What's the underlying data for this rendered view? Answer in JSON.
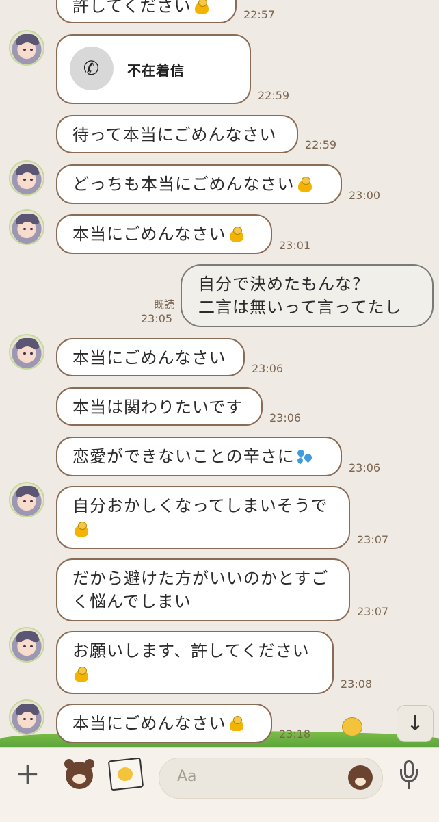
{
  "messages": [
    {
      "text": "許してください",
      "time": "22:57"
    },
    {
      "type": "missed_call",
      "label": "不在着信",
      "time": "22:59"
    },
    {
      "text": "待って本当にごめんなさい",
      "time": "22:59"
    },
    {
      "text": "どっちも本当にごめんなさい",
      "time": "23:00"
    },
    {
      "text": "本当にごめんなさい",
      "time": "23:01"
    },
    {
      "direction": "out",
      "line1": "自分で決めたもんな？",
      "line2": "二言は無いって言ってたし",
      "read": "既読",
      "time": "23:05"
    },
    {
      "text": "本当にごめんなさい",
      "time": "23:06"
    },
    {
      "text": "本当は関わりたいです",
      "time": "23:06"
    },
    {
      "text": "恋愛ができないことの辛さに",
      "time": "23:06"
    },
    {
      "text": "自分おかしくなってしまいそうで",
      "time": "23:07"
    },
    {
      "line1": "だから避けた方がいいのかとすご",
      "line2": "く悩んでしまい",
      "time": "23:07"
    },
    {
      "text": "お願いします、許してください",
      "time": "23:08"
    },
    {
      "text": "本当にごめんなさい",
      "time": "23:18"
    }
  ],
  "input": {
    "placeholder": "Aa"
  },
  "icons": {
    "bow": "person-bowing-emoji",
    "sweat": "sweat-droplets-emoji",
    "phone": "phone-icon",
    "down": "arrow-down-icon",
    "mic": "microphone-icon"
  },
  "colors": {
    "background": "#efebe4",
    "incoming_border": "#8a6b55",
    "outgoing_bubble": "#f0efe9",
    "time_text": "#7a6650"
  }
}
